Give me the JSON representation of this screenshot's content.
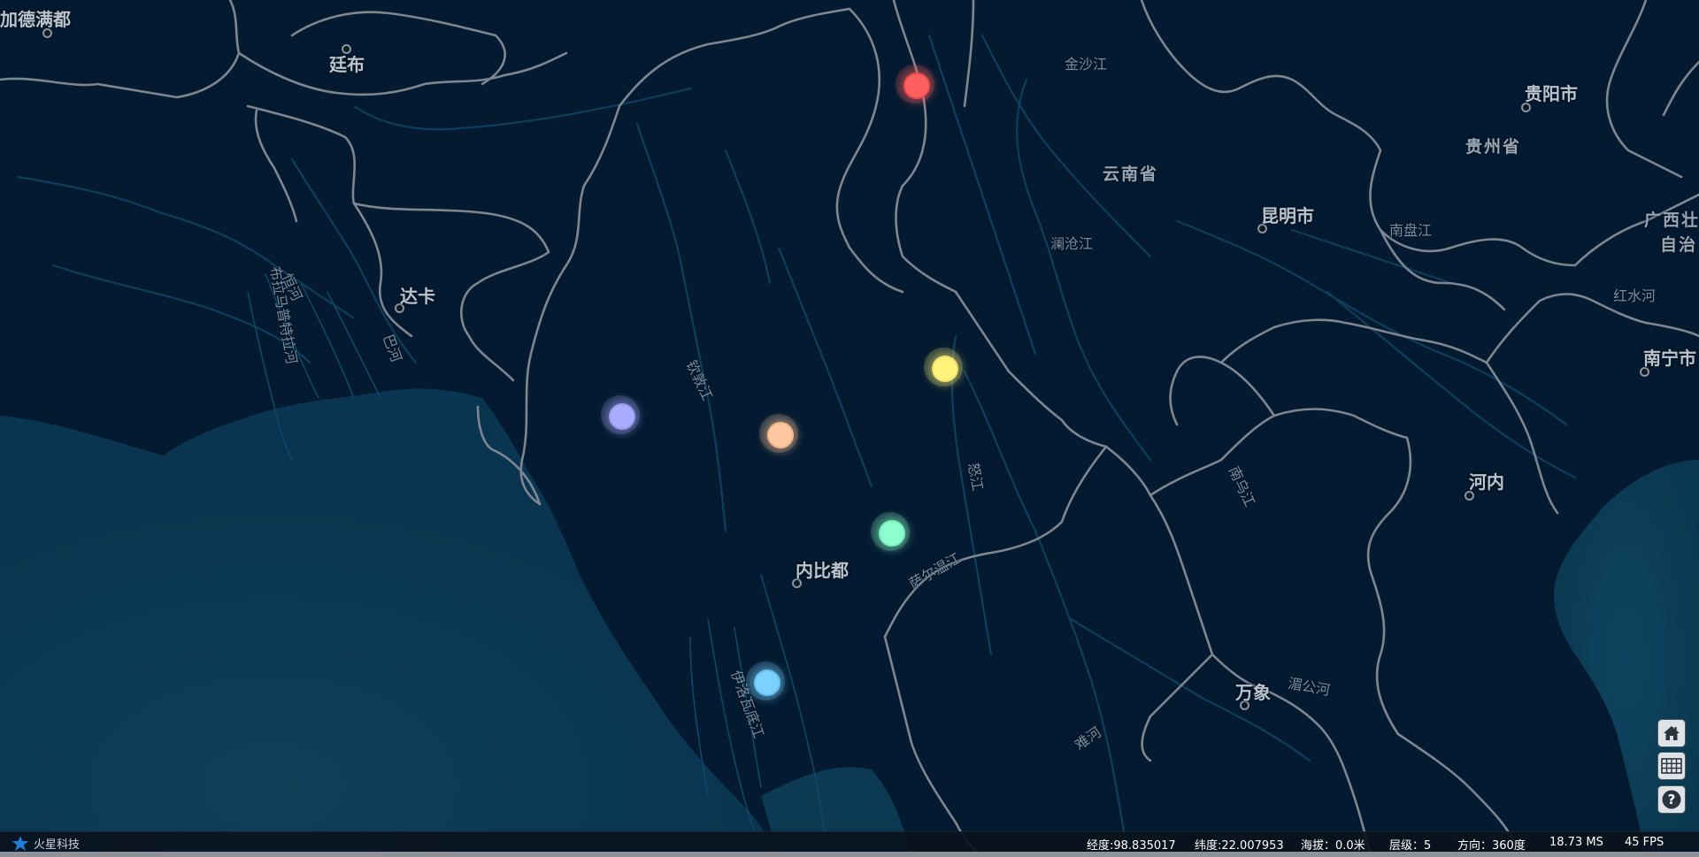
{
  "map": {
    "labels": {
      "dhaka": "达卡",
      "naypyidaw": "内比都",
      "vientiane": "万象",
      "hanoi": "河内",
      "kunming": "昆明市",
      "guiyang": "贵阳市",
      "nanning": "南宁市",
      "thimphu": "廷布",
      "kathmandu": "加德满都",
      "yunnan": "云南省",
      "guizhou": "贵州省",
      "guangxi_1": "广西壮",
      "guangxi_2": "自治",
      "jinsha": "金沙江",
      "lancang": "澜沧江",
      "nanpan": "南盘江",
      "hongshui": "红水河",
      "brahmaputra": "布拉马普特拉河",
      "ganges": "恒河",
      "padma": "巴河",
      "chindwin": "钦敦江",
      "nu": "怒江",
      "salween": "萨尔温江",
      "irrawaddy": "伊洛瓦底江",
      "nanwu": "南乌江",
      "nan": "难河",
      "mekong": "湄公河"
    },
    "markers": [
      {
        "name": "red",
        "color": "#ff5f5f"
      },
      {
        "name": "yellow",
        "color": "#fff27a"
      },
      {
        "name": "purple",
        "color": "#a9acff"
      },
      {
        "name": "peach",
        "color": "#ffc8a0"
      },
      {
        "name": "mint",
        "color": "#8dffcc"
      },
      {
        "name": "blue",
        "color": "#7bd2ff"
      }
    ]
  },
  "tools": {
    "home_icon": "home-icon",
    "basemap_icon": "grid-icon",
    "help_icon": "question-icon"
  },
  "status": {
    "logo_text": "火星科技",
    "longitude": "经度:98.835017",
    "latitude": "纬度:22.007953",
    "altitude": "海拔：0.0米",
    "level": "层级：5",
    "heading": "方向：360度",
    "ms": "18.73 MS",
    "fps": "45 FPS"
  }
}
